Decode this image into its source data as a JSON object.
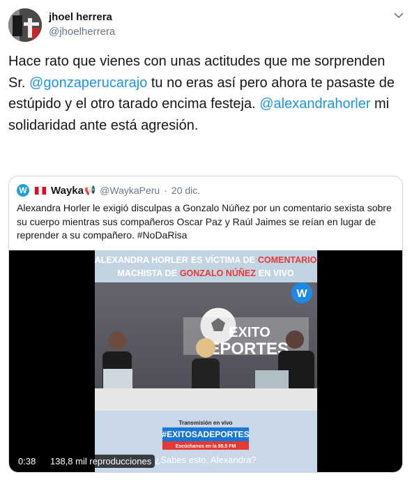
{
  "author": {
    "name": "jhoel herrera",
    "handle": "@jhoelherrera"
  },
  "tweet": {
    "text_1": "Hace rato que vienes con unas actitudes que me sorprenden Sr. ",
    "mention_1": "@gonzaperucarajo",
    "text_2": "  tu no eras así pero ahora te pasaste de estúpido y el otro tarado encima festeja. ",
    "mention_2": "@alexandrahorler",
    "text_3": " mi solidaridad ante está agresión."
  },
  "quoted": {
    "logo_letter": "W",
    "name": "Wayka",
    "megaphone": "📢",
    "handle": "@WaykaPeru",
    "separator": "·",
    "date": "20 dic.",
    "text": "Alexandra Horler le exigió disculpas a Gonzalo Núñez por un comentario sexista sobre su cuerpo mientras sus compañeros Oscar Paz y Raúl Jaimes se reían en lugar de reprender a su compañero. #NoDaRisa"
  },
  "video": {
    "banner_line1_a": "ALEXANDRA HORLER",
    "banner_line1_b": "ES VÍCTIMA DE",
    "banner_line1_c": "COMENTARIO",
    "banner_line2_a": "MACHISTA DE",
    "banner_line2_b": "GONZALO NÚÑEZ",
    "banner_line2_c": "EN VIVO",
    "logo_letter": "W",
    "sign_top": "EXITO",
    "sign_bottom": "DEPORTES",
    "live_label": "Transmisión en vivo",
    "hashtag": "#EXITOSADEPORTES",
    "listen": "Escúchanos en la 95.5 FM",
    "caption": "¿Sabes esto, Alexandra?",
    "duration": "0:38",
    "views": "138,8 mil reproducciones"
  },
  "colors": {
    "link": "#1b95e0",
    "text": "#14171a",
    "secondary": "#657786",
    "border": "#ccd6dd"
  }
}
